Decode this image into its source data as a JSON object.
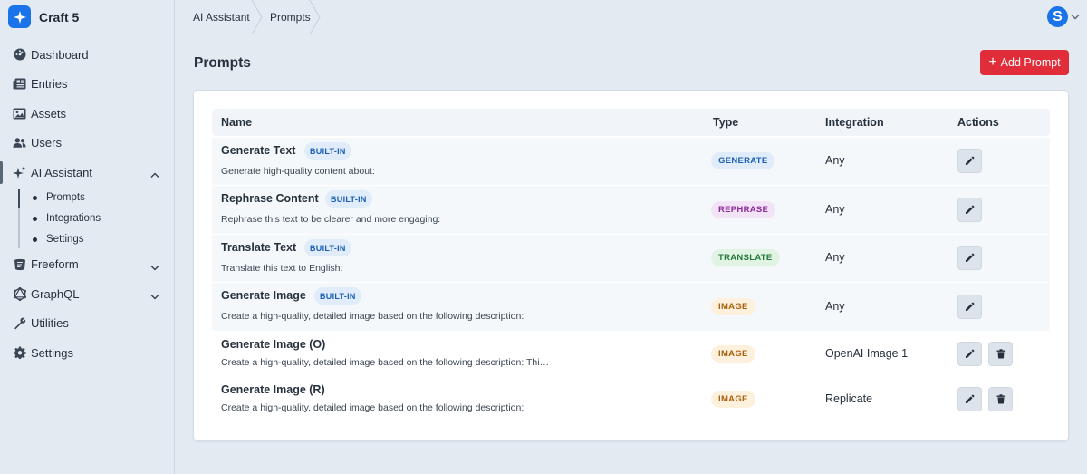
{
  "app": {
    "name": "Craft 5"
  },
  "colors": {
    "accent": "#1a73e8",
    "danger": "#e12d39"
  },
  "sidebar": {
    "items": [
      {
        "label": "Dashboard",
        "icon": "dashboard-gauge-icon"
      },
      {
        "label": "Entries",
        "icon": "newspaper-icon"
      },
      {
        "label": "Assets",
        "icon": "image-icon"
      },
      {
        "label": "Users",
        "icon": "users-icon"
      },
      {
        "label": "AI Assistant",
        "icon": "sparkle-icon",
        "expanded": true,
        "children": [
          {
            "label": "Prompts"
          },
          {
            "label": "Integrations"
          },
          {
            "label": "Settings"
          }
        ]
      },
      {
        "label": "Freeform",
        "icon": "freeform-icon"
      },
      {
        "label": "GraphQL",
        "icon": "graphql-icon"
      },
      {
        "label": "Utilities",
        "icon": "wrench-icon"
      },
      {
        "label": "Settings",
        "icon": "gear-icon"
      }
    ]
  },
  "breadcrumb": [
    "AI Assistant",
    "Prompts"
  ],
  "user": {
    "avatar_letter": "S"
  },
  "page": {
    "title": "Prompts",
    "add_button": "Add Prompt"
  },
  "table": {
    "headers": {
      "name": "Name",
      "type": "Type",
      "integration": "Integration",
      "actions": "Actions"
    },
    "builtin_label": "BUILT-IN",
    "rows": [
      {
        "name": "Generate Text",
        "builtin": true,
        "desc": "Generate high-quality content about:",
        "type": "GENERATE",
        "integration": "Any",
        "deletable": false
      },
      {
        "name": "Rephrase Content",
        "builtin": true,
        "desc": "Rephrase this text to be clearer and more engaging:",
        "type": "REPHRASE",
        "integration": "Any",
        "deletable": false
      },
      {
        "name": "Translate Text",
        "builtin": true,
        "desc": "Translate this text to English:",
        "type": "TRANSLATE",
        "integration": "Any",
        "deletable": false
      },
      {
        "name": "Generate Image",
        "builtin": true,
        "desc": "Create a high-quality, detailed image based on the following description:",
        "type": "IMAGE",
        "integration": "Any",
        "deletable": false
      },
      {
        "name": "Generate Image (O)",
        "builtin": false,
        "desc": "Create a high-quality, detailed image based on the following description: Thi…",
        "type": "IMAGE",
        "integration": "OpenAI Image 1",
        "deletable": true
      },
      {
        "name": "Generate Image (R)",
        "builtin": false,
        "desc": "Create a high-quality, detailed image based on the following description:",
        "type": "IMAGE",
        "integration": "Replicate",
        "deletable": true
      }
    ]
  },
  "type_colors": {
    "GENERATE": {
      "bg": "#e0ecfa",
      "fg": "#1a5fb4"
    },
    "REPHRASE": {
      "bg": "#f3e3f6",
      "fg": "#8b2a9a"
    },
    "TRANSLATE": {
      "bg": "#e1f4e4",
      "fg": "#24793a"
    },
    "IMAGE": {
      "bg": "#fdf0dc",
      "fg": "#a8620f"
    }
  }
}
